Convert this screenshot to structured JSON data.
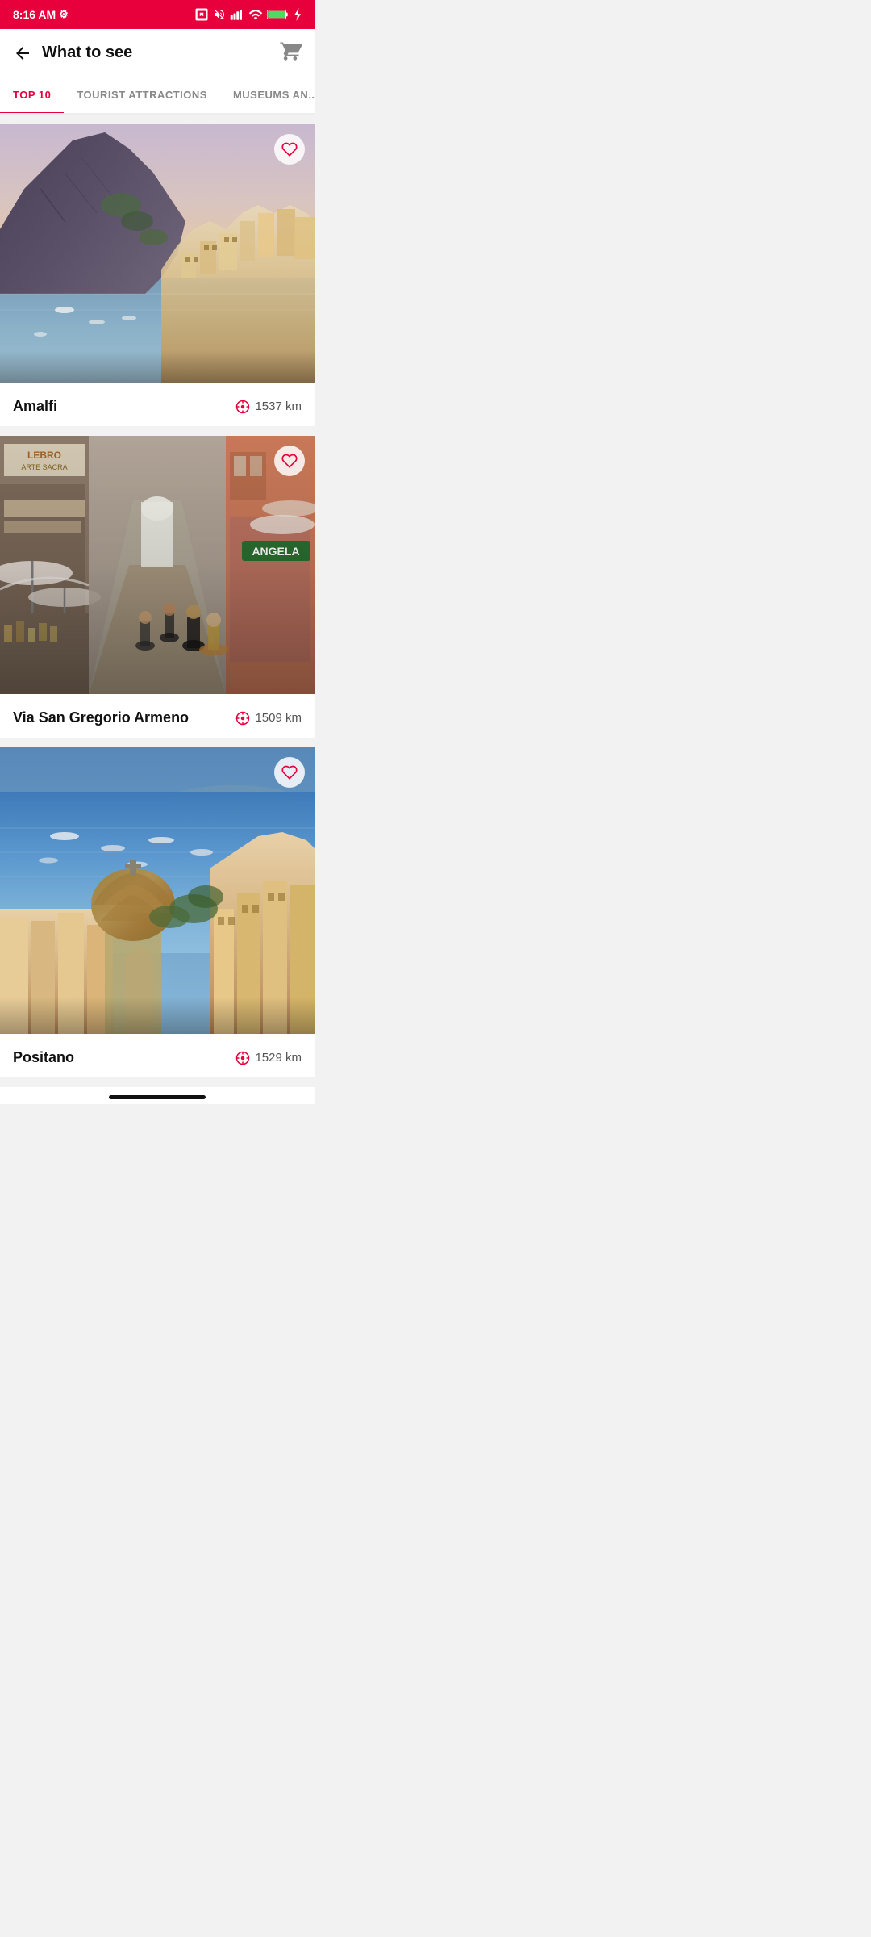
{
  "statusBar": {
    "time": "8:16 AM",
    "battery": "100"
  },
  "header": {
    "title": "What to see",
    "backLabel": "Back",
    "cartLabel": "Cart"
  },
  "tabs": [
    {
      "id": "top10",
      "label": "TOP 10",
      "active": true
    },
    {
      "id": "tourist",
      "label": "TOURIST ATTRACTIONS",
      "active": false
    },
    {
      "id": "museums",
      "label": "MUSEUMS AN...",
      "active": false
    }
  ],
  "cards": [
    {
      "id": "amalfi",
      "name": "Amalfi",
      "distance": "1537 km",
      "favorited": false
    },
    {
      "id": "via-san-gregorio",
      "name": "Via San Gregorio Armeno",
      "distance": "1509 km",
      "favorited": false
    },
    {
      "id": "positano",
      "name": "Positano",
      "distance": "1529 km",
      "favorited": false
    }
  ],
  "icons": {
    "heart": "♡",
    "compass": "⊙",
    "back": "←",
    "cart": "🛒"
  }
}
